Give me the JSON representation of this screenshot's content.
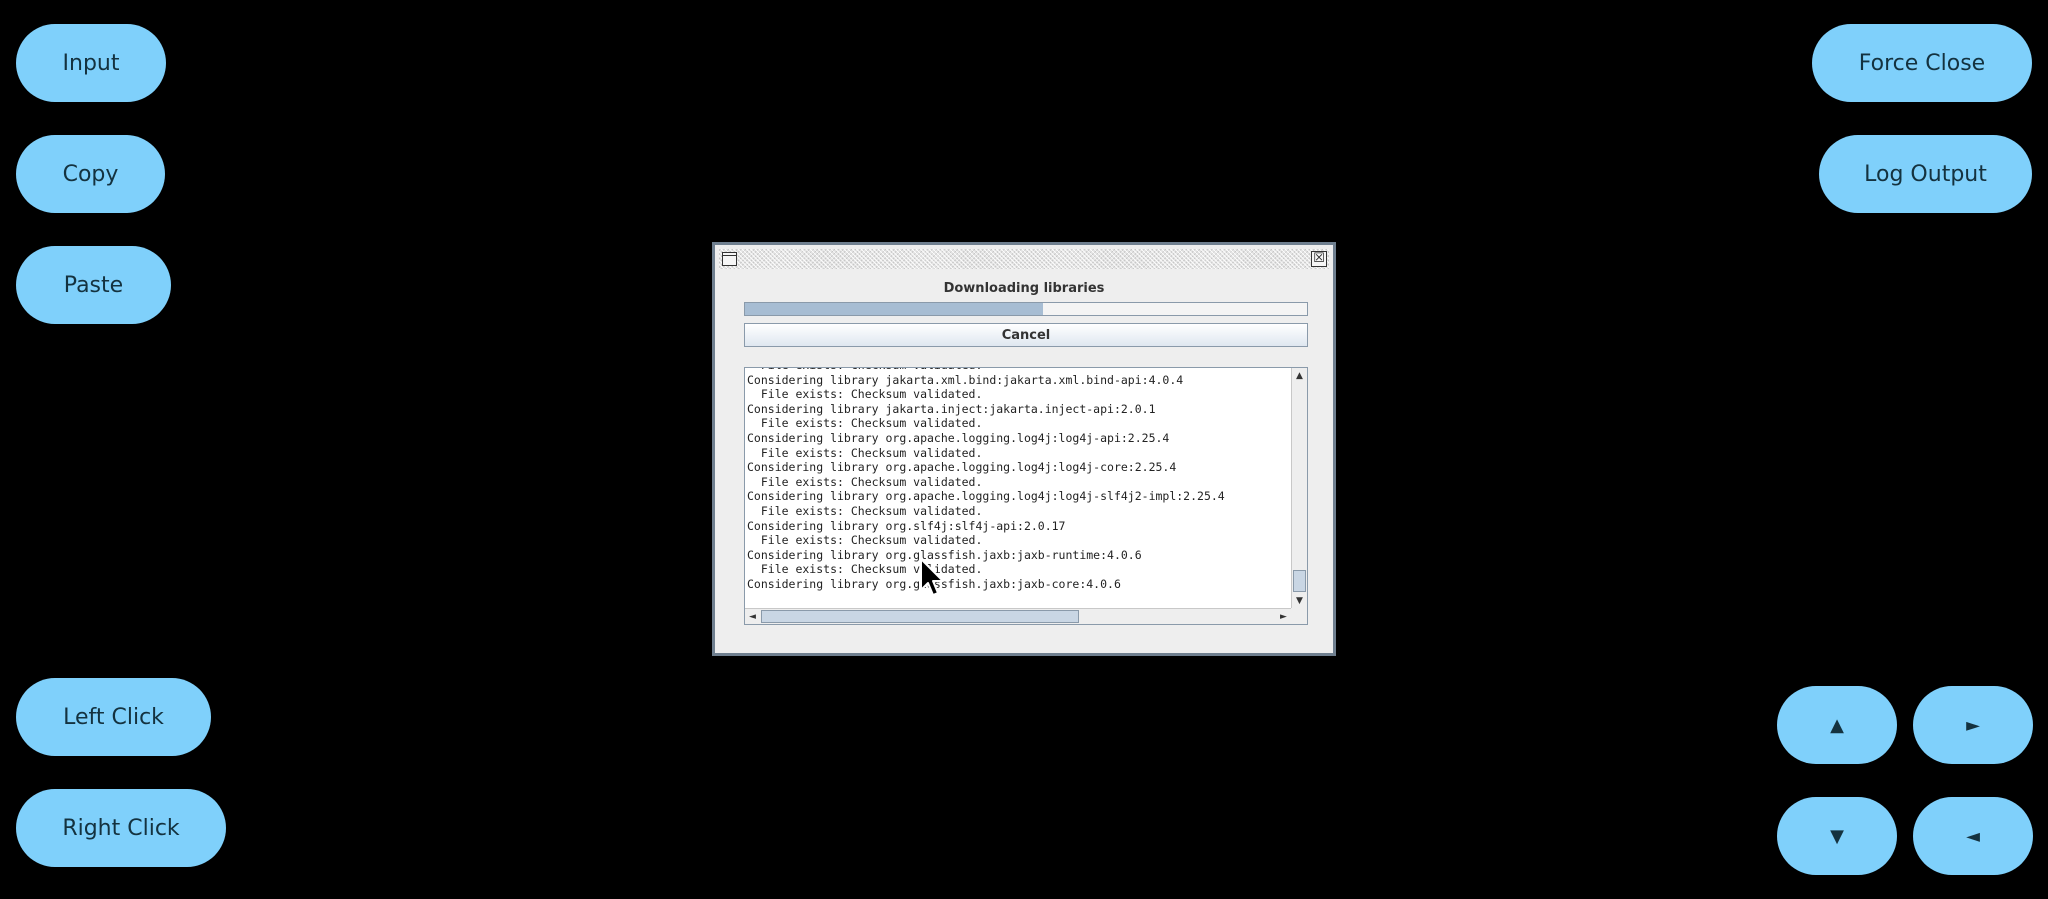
{
  "side_buttons": {
    "input": "Input",
    "copy": "Copy",
    "paste": "Paste",
    "left_click": "Left Click",
    "right_click": "Right Click",
    "force_close": "Force Close",
    "log_output": "Log Output",
    "arrow_up": "▲",
    "arrow_right": "►",
    "arrow_down": "▼",
    "arrow_left": "◄"
  },
  "dialog": {
    "title_icon": "window-icon",
    "close_glyph": "☒",
    "label": "Downloading libraries",
    "progress_fraction": 0.53,
    "cancel_label": "Cancel",
    "log_lines": [
      "  File exists: Checksum validated.",
      "Considering library jakarta.xml.bind:jakarta.xml.bind-api:4.0.4",
      "  File exists: Checksum validated.",
      "Considering library jakarta.inject:jakarta.inject-api:2.0.1",
      "  File exists: Checksum validated.",
      "Considering library org.apache.logging.log4j:log4j-api:2.25.4",
      "  File exists: Checksum validated.",
      "Considering library org.apache.logging.log4j:log4j-core:2.25.4",
      "  File exists: Checksum validated.",
      "Considering library org.apache.logging.log4j:log4j-slf4j2-impl:2.25.4",
      "  File exists: Checksum validated.",
      "Considering library org.slf4j:slf4j-api:2.0.17",
      "  File exists: Checksum validated.",
      "Considering library org.glassfish.jaxb:jaxb-runtime:4.0.6",
      "  File exists: Checksum validated.",
      "Considering library org.glassfish.jaxb:jaxb-core:4.0.6"
    ]
  },
  "colors": {
    "background": "#000000",
    "button": "#7fd0fb",
    "button_text": "#14323f",
    "progress_fill": "#a7bdd3"
  }
}
